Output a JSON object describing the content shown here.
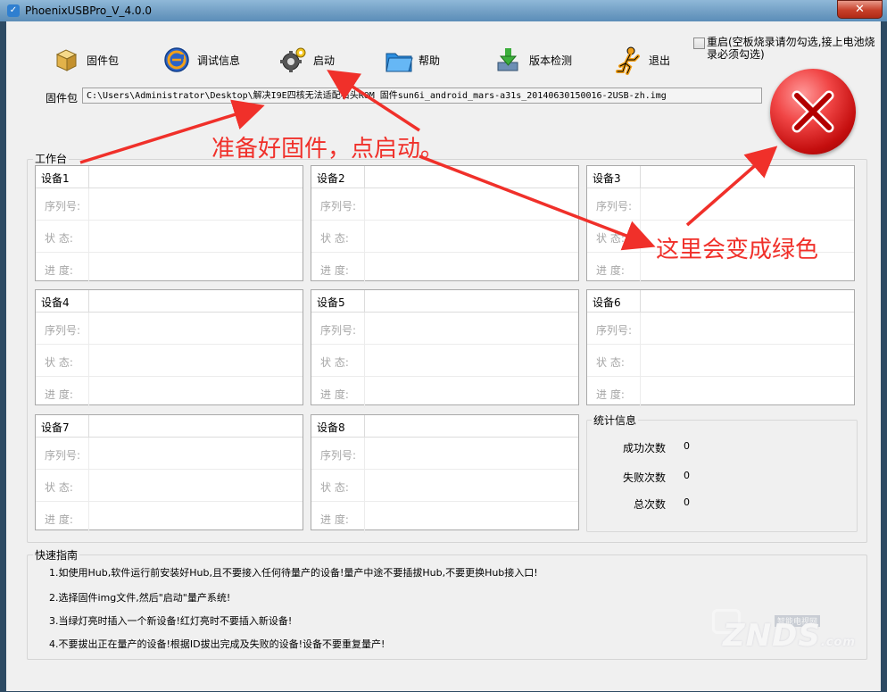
{
  "window": {
    "title": "PhoenixUSBPro_V_4.0.0",
    "app_icon": "phoenix-usb-icon",
    "close_symbol": "✕"
  },
  "toolbar": {
    "firmware_label": "固件包",
    "debug_label": "调试信息",
    "start_label": "启动",
    "help_label": "帮助",
    "version_label": "版本检测",
    "exit_label": "退出"
  },
  "restart_option": {
    "label": "重启(空板烧录请勿勾选,接上电池烧录必须勾选)",
    "checked": false
  },
  "firmware": {
    "label": "固件包",
    "path": "C:\\Users\\Administrator\\Desktop\\解决I9E四核无法适配石头ROM 固件sun6i_android_mars-a31s_20140630150016-2USB-zh.img"
  },
  "status_indicator": {
    "state": "red",
    "icon": "red-x-icon"
  },
  "workbench": {
    "title": "工作台",
    "row_labels": {
      "serial": "序列号:",
      "status": "状  态:",
      "progress": "进  度:"
    },
    "devices": [
      {
        "name": "设备1",
        "serial": "",
        "status": "",
        "progress": ""
      },
      {
        "name": "设备2",
        "serial": "",
        "status": "",
        "progress": ""
      },
      {
        "name": "设备3",
        "serial": "",
        "status": "",
        "progress": ""
      },
      {
        "name": "设备4",
        "serial": "",
        "status": "",
        "progress": ""
      },
      {
        "name": "设备5",
        "serial": "",
        "status": "",
        "progress": ""
      },
      {
        "name": "设备6",
        "serial": "",
        "status": "",
        "progress": ""
      },
      {
        "name": "设备7",
        "serial": "",
        "status": "",
        "progress": ""
      },
      {
        "name": "设备8",
        "serial": "",
        "status": "",
        "progress": ""
      }
    ]
  },
  "stats": {
    "title": "统计信息",
    "success_label": "成功次数",
    "success_value": "0",
    "fail_label": "失败次数",
    "fail_value": "0",
    "total_label": "总次数",
    "total_value": "0"
  },
  "guide": {
    "title": "快速指南",
    "items": [
      "1.如使用Hub,软件运行前安装好Hub,且不要接入任何待量产的设备!量产中途不要插拔Hub,不要更换Hub接入口!",
      "2.选择固件img文件,然后\"启动\"量产系统!",
      "3.当绿灯亮时插入一个新设备!红灯亮时不要插入新设备!",
      "4.不要拔出正在量产的设备!根据ID拔出完成及失败的设备!设备不要重复量产!"
    ]
  },
  "annotations": {
    "ready_text": "准备好固件，点启动。",
    "green_text": "这里会变成绿色",
    "arrow_color": "#f0302a"
  },
  "watermark": {
    "main": "ZNDS",
    "sub": "智能电视网",
    "suffix": ".com"
  }
}
